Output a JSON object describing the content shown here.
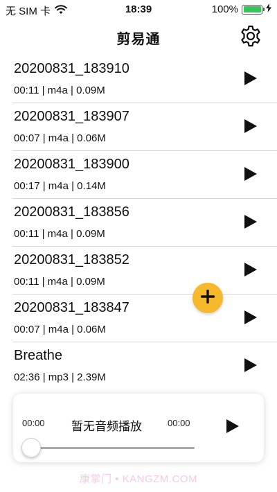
{
  "status_bar": {
    "carrier": "无 SIM 卡",
    "time": "18:39",
    "battery_percent": "100%",
    "battery_level": 1.0
  },
  "nav": {
    "title": "剪易通"
  },
  "recordings": [
    {
      "title": "20200831_183910",
      "meta": "00:11 | m4a | 0.09M"
    },
    {
      "title": "20200831_183907",
      "meta": "00:07 | m4a | 0.06M"
    },
    {
      "title": "20200831_183900",
      "meta": "00:17 | m4a | 0.14M"
    },
    {
      "title": "20200831_183856",
      "meta": "00:11 | m4a | 0.09M"
    },
    {
      "title": "20200831_183852",
      "meta": "00:11 | m4a | 0.09M"
    },
    {
      "title": "20200831_183847",
      "meta": "00:07 | m4a | 0.06M"
    },
    {
      "title": "Breathe",
      "meta": "02:36 | mp3 | 2.39M"
    }
  ],
  "player": {
    "current_time": "00:00",
    "title": "暂无音频播放",
    "duration": "00:00",
    "progress": 0
  },
  "watermark": "康掌门 • KANGZM.COM",
  "colors": {
    "fab": "#f6b92b",
    "battery": "#34c759",
    "watermark": "#f7c9e3"
  }
}
